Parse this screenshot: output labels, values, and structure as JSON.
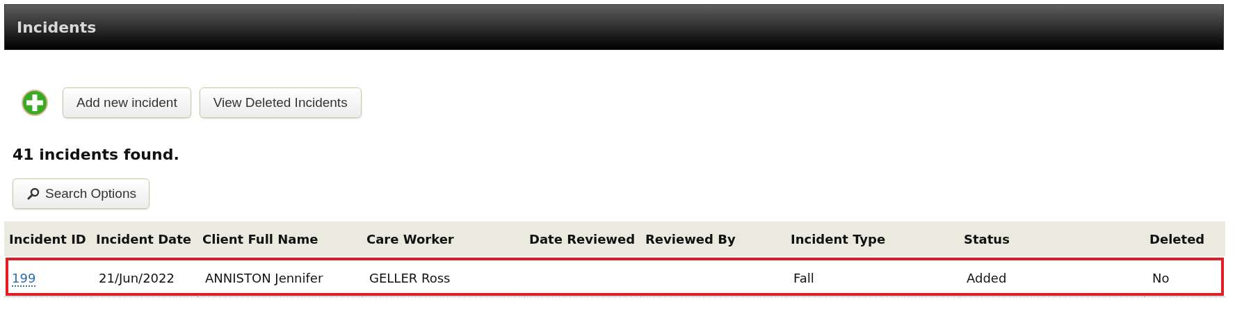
{
  "page": {
    "title": "Incidents"
  },
  "actions": [
    {
      "label": "Add new incident"
    },
    {
      "label": "View Deleted Incidents"
    }
  ],
  "result_count": "41 incidents found.",
  "search_button": {
    "label": "Search Options"
  },
  "table": {
    "columns": [
      "Incident ID",
      "Incident Date",
      "Client Full Name",
      "Care Worker",
      "Date Reviewed",
      "Reviewed By",
      "Incident Type",
      "Status",
      "Deleted"
    ],
    "rows": [
      {
        "selected": true,
        "cells": [
          "199",
          "21/Jun/2022",
          "ANNISTON Jennifer",
          "GELLER Ross",
          "",
          "",
          "Fall",
          "Added",
          "No"
        ]
      }
    ]
  }
}
